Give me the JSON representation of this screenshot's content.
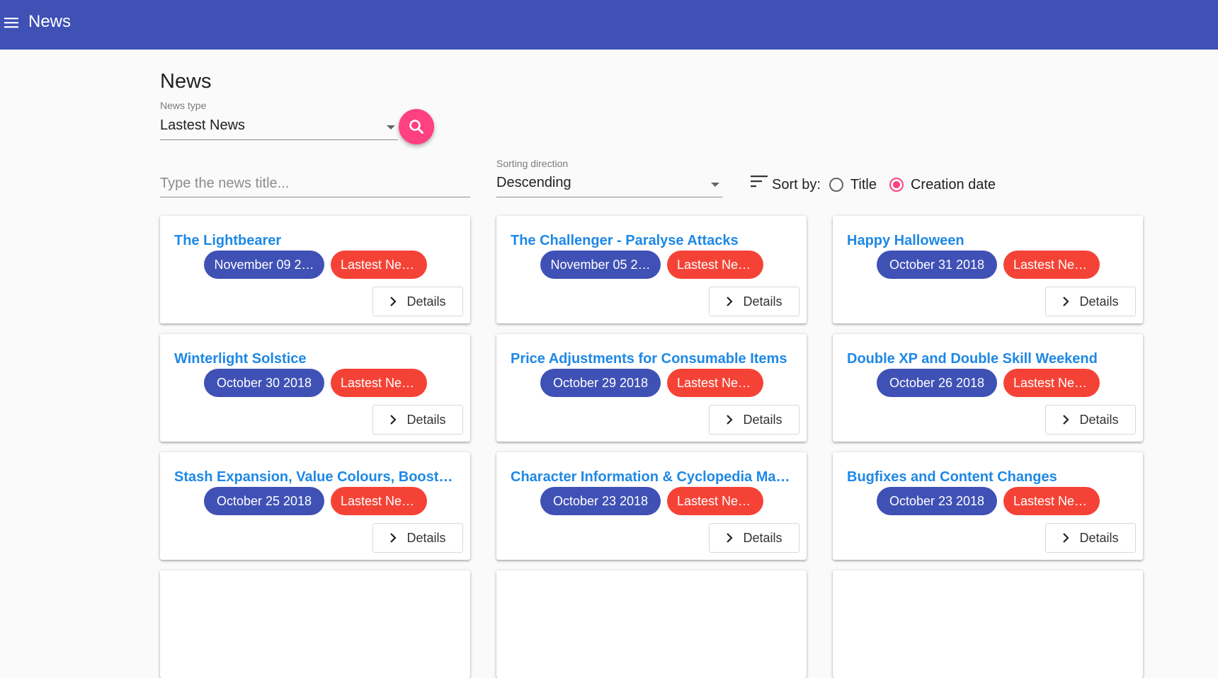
{
  "appbar": {
    "title": "News",
    "menu_icon": "menu-icon"
  },
  "page": {
    "title": "News"
  },
  "filters": {
    "news_type_label": "News type",
    "news_type_value": "Lastest News",
    "search_placeholder": "Type the news title...",
    "sort_direction_label": "Sorting direction",
    "sort_direction_value": "Descending",
    "sort_by_label": "Sort by:",
    "sort_options": [
      {
        "label": "Title",
        "checked": false
      },
      {
        "label": "Creation date",
        "checked": true
      }
    ]
  },
  "colors": {
    "primary": "#3f51b5",
    "accent": "#ff4081",
    "badge": "#f44336",
    "link": "#1e88e5"
  },
  "news": [
    {
      "title": "The Lightbearer",
      "date": "November 09 2…",
      "type": "Lastest News",
      "details": "Details"
    },
    {
      "title": "The Challenger - Paralyse Attacks",
      "date": "November 05 2…",
      "type": "Lastest News",
      "details": "Details"
    },
    {
      "title": "Happy Halloween",
      "date": "October 31 2018",
      "type": "Lastest News",
      "details": "Details"
    },
    {
      "title": "Winterlight Solstice",
      "date": "October 30 2018",
      "type": "Lastest News",
      "details": "Details"
    },
    {
      "title": "Price Adjustments for Consumable Items",
      "date": "October 29 2018",
      "type": "Lastest News",
      "details": "Details"
    },
    {
      "title": "Double XP and Double Skill Weekend",
      "date": "October 26 2018",
      "type": "Lastest News",
      "details": "Details"
    },
    {
      "title": "Stash Expansion, Value Colours, Boost…",
      "date": "October 25 2018",
      "type": "Lastest News",
      "details": "Details"
    },
    {
      "title": "Character Information & Cyclopedia Ma…",
      "date": "October 23 2018",
      "type": "Lastest News",
      "details": "Details"
    },
    {
      "title": "Bugfixes and Content Changes",
      "date": "October 23 2018",
      "type": "Lastest News",
      "details": "Details"
    }
  ]
}
